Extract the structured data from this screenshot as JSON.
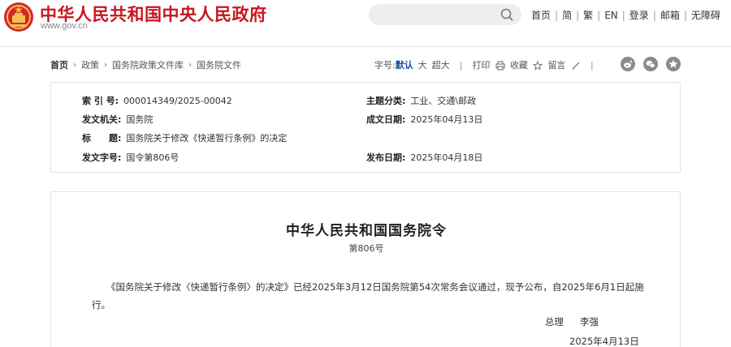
{
  "header": {
    "site_name": "中华人民共和国中央人民政府",
    "site_url": "www.gov.cn",
    "nav": [
      "首页",
      "简",
      "繁",
      "EN",
      "登录",
      "邮箱",
      "无障碍"
    ]
  },
  "breadcrumb": {
    "items": [
      "首页",
      "政策",
      "国务院政策文件库",
      "国务院文件"
    ]
  },
  "tools": {
    "font_label": "字号:",
    "font_default": "默认",
    "font_large": "大",
    "font_xlarge": "超大",
    "print": "打印",
    "favorite": "收藏",
    "comment": "留言"
  },
  "meta": {
    "index_label": "索 引 号:",
    "index_value": "000014349/2025-00042",
    "category_label": "主题分类:",
    "category_value": "工业、交通\\邮政",
    "issuer_label": "发文机关:",
    "issuer_value": "国务院",
    "written_label": "成文日期:",
    "written_value": "2025年04月13日",
    "title_label": "标　　题:",
    "title_value": "国务院关于修改《快递暂行条例》的决定",
    "docno_label": "发文字号:",
    "docno_value": "国令第806号",
    "published_label": "发布日期:",
    "published_value": "2025年04月18日"
  },
  "document": {
    "title": "中华人民共和国国务院令",
    "number": "第806号",
    "paragraph": "《国务院关于修改〈快递暂行条例〉的决定》已经2025年3月12日国务院第54次常务会议通过，现予公布，自2025年6月1日起施行。",
    "signer_title": "总理",
    "signer_name": "李强",
    "date": "2025年4月13日"
  },
  "colors": {
    "brand_red": "#c8161e",
    "active_blue": "#1a4fa0"
  }
}
